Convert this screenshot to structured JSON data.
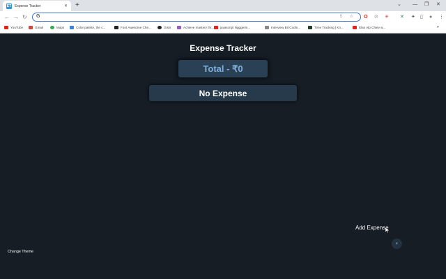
{
  "browser": {
    "tab": {
      "title": "Expense Tracker",
      "favicon": "ET"
    },
    "new_tab": "+",
    "window_controls": {
      "minimize": "—",
      "restore": "❐",
      "close": "✕",
      "collapse": "⌄"
    },
    "nav": {
      "back": "←",
      "forward": "→",
      "reload": "↻"
    },
    "omnibox": {
      "value": "",
      "g_icon": "G",
      "icons": "⇪ ☆"
    },
    "extensions": {
      "opera": "O",
      "ext2": "⊘",
      "ext3": "✳",
      "ext4": "✕",
      "puzzle": "✦",
      "sidepanel": "▯",
      "profile": "●",
      "menu": "⋮"
    },
    "bookmarks": [
      {
        "label": "YouTube",
        "color": "#e62117"
      },
      {
        "label": "Gmail",
        "color": "#d44638"
      },
      {
        "label": "Maps",
        "color": "#34a853"
      },
      {
        "label": "Color palette, the c...",
        "color": "#3b82d6"
      },
      {
        "label": "Font Awesome Che...",
        "color": "#222222"
      },
      {
        "label": "Gists",
        "color": "#222222"
      },
      {
        "label": "Achieve mastery thr...",
        "color": "#9a5cc0"
      },
      {
        "label": "javascript Ngggerin...",
        "color": "#e62117"
      },
      {
        "label": "Interview Bit Codin...",
        "color": "#888888"
      },
      {
        "label": "Time Tracking | Kn...",
        "color": "#1f3d2b"
      },
      {
        "label": "Elan Alp Chiev w...",
        "color": "#e62117"
      }
    ],
    "bookmarks_more": "»"
  },
  "app": {
    "title": "Expense Tracker",
    "total_label": "Total - ₹0",
    "empty_label": "No Expense",
    "add_expense_label": "Add Expense",
    "fab_label": "+",
    "change_theme_label": "Change Theme",
    "colors": {
      "background": "#161d25",
      "total_card": "#2a4054",
      "total_text": "#7fb0dc",
      "empty_card": "#263a4b"
    }
  }
}
